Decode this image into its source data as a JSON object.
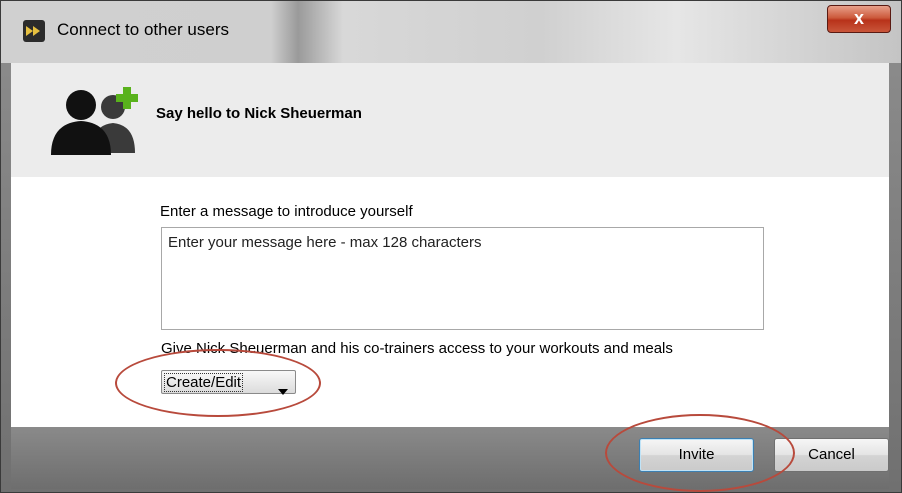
{
  "window": {
    "title": "Connect to other users",
    "close_label": "x"
  },
  "header": {
    "title": "Say hello to Nick Sheuerman",
    "icon": "add-users-icon"
  },
  "form": {
    "prompt_label": "Enter a message to introduce yourself",
    "message": {
      "value": "Enter your message here - max 128 characters",
      "placeholder": "Enter your message here - max 128 characters"
    },
    "access_label": "Give Nick Sheuerman and his co-trainers access to your workouts and meals",
    "access_selected": "Create/Edit"
  },
  "buttons": {
    "invite": "Invite",
    "cancel": "Cancel"
  },
  "colors": {
    "annotation": "#b84a3c",
    "close_button": "#c9563a",
    "focus_border": "#3c7fb1"
  }
}
